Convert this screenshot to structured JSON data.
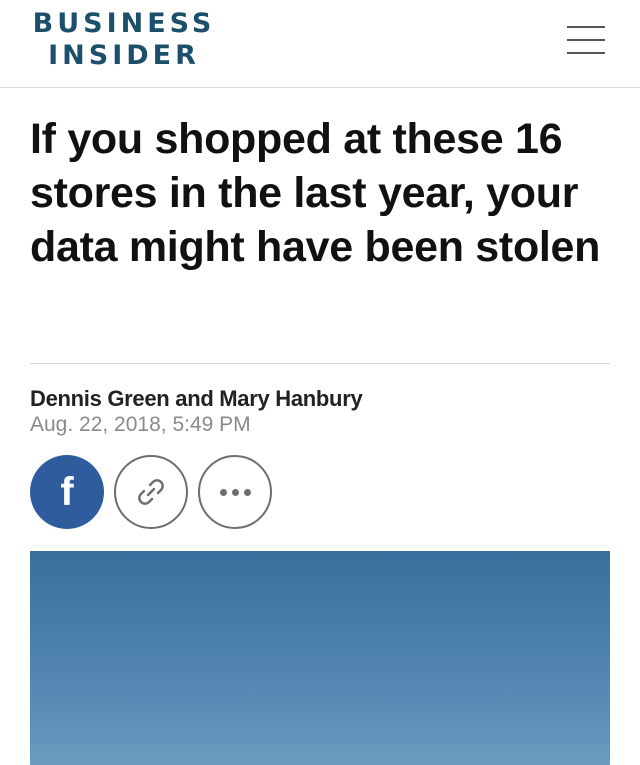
{
  "header": {
    "logo_line1": "BUSINESS",
    "logo_line2": "INSIDER",
    "menu_icon": "hamburger-menu-icon"
  },
  "article": {
    "headline": "If you shopped at these 16 stores in the last year, your data might have been stolen",
    "byline": "Dennis Green and Mary Hanbury",
    "timestamp": "Aug. 22, 2018, 5:49 PM"
  },
  "share": {
    "facebook_glyph": "f",
    "facebook_icon": "facebook-icon",
    "link_icon": "link-icon",
    "more_icon": "more-dots-icon"
  },
  "colors": {
    "brand": "#1b4f6b",
    "facebook": "#2f5c9c",
    "hero_sky": "#4a7fab"
  }
}
